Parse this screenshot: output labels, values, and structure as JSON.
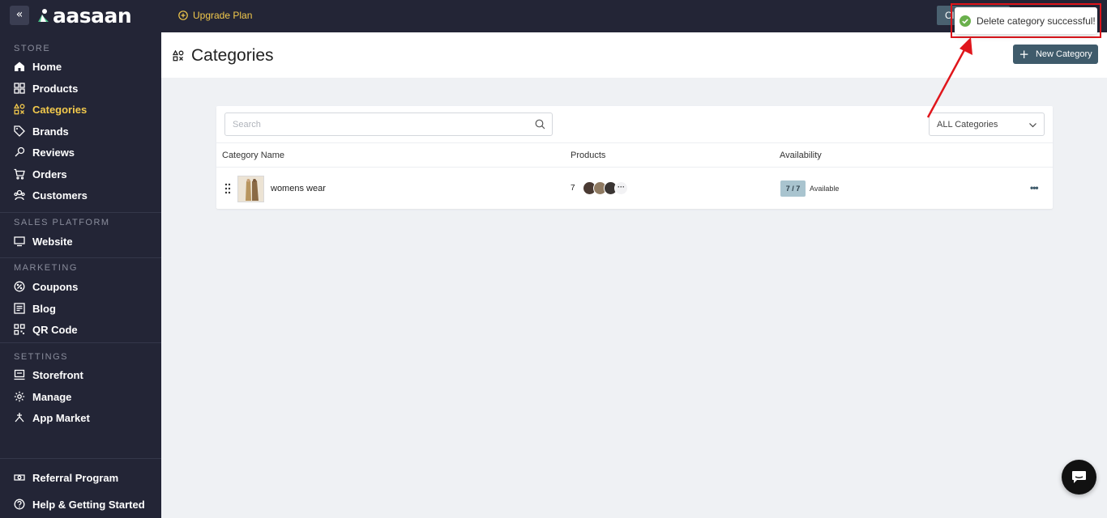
{
  "topbar": {
    "logo_text": "aasaan",
    "upgrade_label": "Upgrade Plan",
    "top_button_label": "Cl"
  },
  "sidebar": {
    "sections": {
      "store": "STORE",
      "sales_platform": "SALES PLATFORM",
      "marketing": "MARKETING",
      "settings": "SETTINGS"
    },
    "items": {
      "home": "Home",
      "products": "Products",
      "categories": "Categories",
      "brands": "Brands",
      "reviews": "Reviews",
      "orders": "Orders",
      "customers": "Customers",
      "website": "Website",
      "coupons": "Coupons",
      "blog": "Blog",
      "qr_code": "QR Code",
      "storefront": "Storefront",
      "manage": "Manage",
      "app_market": "App Market",
      "referral": "Referral Program",
      "help": "Help & Getting Started"
    },
    "active_item": "categories",
    "accent_color": "#f2c94c"
  },
  "header": {
    "title": "Categories",
    "new_button_label": "New Category"
  },
  "table": {
    "search_placeholder": "Search",
    "filter_value": "ALL Categories",
    "columns": [
      "Category Name",
      "Products",
      "Availability"
    ],
    "rows": [
      {
        "name": "womens wear",
        "products_count": "7",
        "availability_ratio": "7 / 7",
        "availability_label": "Available"
      }
    ]
  },
  "toast": {
    "message": "Delete category successful!",
    "status": "success",
    "status_color": "#6ab04c",
    "highlight_color": "#e0161c"
  },
  "icons": {
    "toast": "check-circle-icon",
    "chat": "chat-bubble-icon"
  }
}
